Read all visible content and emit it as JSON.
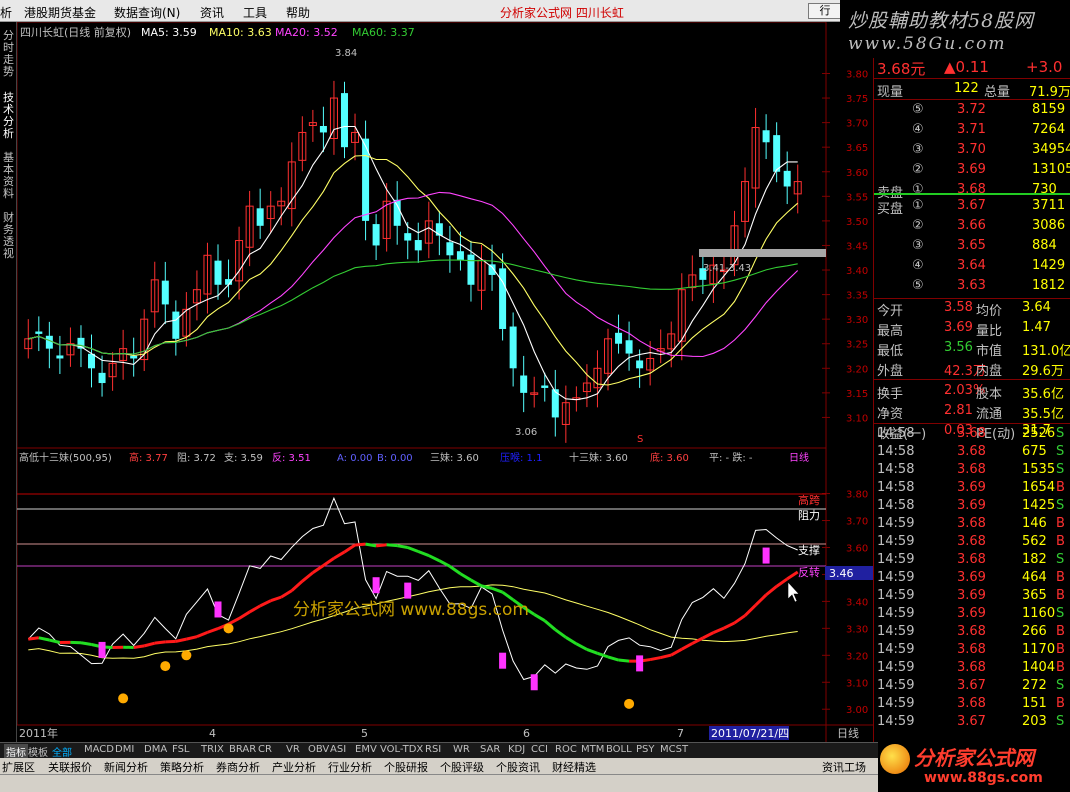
{
  "menu": {
    "items": [
      "析",
      "港股期货基金",
      "数据查询(N)",
      "资讯",
      "工具",
      "帮助"
    ],
    "title": "分析家公式网 四川长虹",
    "mini_btn": "行"
  },
  "watermark": {
    "title": "炒股輔助教材58股网",
    "url": "www.58Gu.com",
    "center_title": "分析家公式网 www.88gs.com",
    "logo_text": "分析家公式网",
    "logo_url": "www.88gs.com"
  },
  "left_tabs": [
    "分时走势",
    "技术分析",
    "基本资料",
    "财务透视"
  ],
  "main_chart": {
    "header": {
      "name": "四川长虹(日线 前复权)",
      "ma5": "MA5: 3.59",
      "ma10": "MA10: 3.63",
      "ma20": "MA20: 3.52",
      "ma60": "MA60: 3.37"
    },
    "ymin": 3.05,
    "ymax": 3.86,
    "y_ticks": [
      "3.80",
      "3.75",
      "3.70",
      "3.65",
      "3.60",
      "3.55",
      "3.50",
      "3.45",
      "3.40",
      "3.35",
      "3.30",
      "3.25",
      "3.20",
      "3.15",
      "3.10"
    ],
    "annotations": {
      "high": "3.84",
      "low": "3.06",
      "band": "3.41-3.43",
      "marker": "S"
    },
    "colors": {
      "up": "#ff3030",
      "down": "#54ffff",
      "ma5": "#ffffff",
      "ma10": "#ffff66",
      "ma20": "#ff44ff",
      "ma60": "#33cc33"
    }
  },
  "chart_data": {
    "type": "candlestick",
    "title": "四川长虹(日线 前复权)",
    "close": [
      3.26,
      3.27,
      3.24,
      3.22,
      3.25,
      3.24,
      3.2,
      3.17,
      3.21,
      3.24,
      3.22,
      3.3,
      3.38,
      3.33,
      3.26,
      3.32,
      3.36,
      3.43,
      3.37,
      3.37,
      3.46,
      3.53,
      3.49,
      3.53,
      3.54,
      3.62,
      3.68,
      3.7,
      3.68,
      3.75,
      3.65,
      3.68,
      3.5,
      3.45,
      3.54,
      3.49,
      3.46,
      3.44,
      3.5,
      3.47,
      3.43,
      3.42,
      3.37,
      3.42,
      3.39,
      3.28,
      3.2,
      3.15,
      3.15,
      3.16,
      3.1,
      3.13,
      3.14,
      3.17,
      3.2,
      3.26,
      3.25,
      3.23,
      3.2,
      3.22,
      3.24,
      3.27,
      3.36,
      3.39,
      3.38,
      3.41,
      3.4,
      3.49,
      3.58,
      3.69,
      3.66,
      3.6,
      3.57,
      3.58
    ],
    "series_visible": [
      "MA5",
      "MA10",
      "MA20",
      "MA60"
    ]
  },
  "indicator": {
    "header": {
      "name": "高低十三妹(500,95)",
      "gao": "高: 3.77",
      "zu": "阻: 3.72",
      "zhi": "支: 3.59",
      "fan": "反: 3.51",
      "a": "A: 0.00",
      "b": "B: 0.00",
      "sanmei": "三妹: 3.60",
      "xihuan": "压喉: 1.1",
      "shisanmei": "十三妹: 3.60",
      "di": "底: 3.60",
      "ping": "平: - 跌: -",
      "period": "日线"
    },
    "ymin": 2.96,
    "ymax": 3.88,
    "y_ticks": [
      "3.80",
      "3.70",
      "3.60",
      "3.50",
      "3.40",
      "3.30",
      "3.20",
      "3.10",
      "3.00"
    ],
    "line_labels": {
      "gao": "高跨",
      "zu": "阻力",
      "zhi": "支撑",
      "fan": "反转",
      "fan_val": "3.46"
    }
  },
  "x_axis": {
    "labels": [
      "2011年",
      "4",
      "5",
      "6",
      "7"
    ],
    "date_box": "2011/07/21/四",
    "period_label": "日线"
  },
  "quote": {
    "price": "3.68元",
    "change": "▲0.11",
    "pct": "+3.0",
    "xianliang_label": "现量",
    "xianliang": "122",
    "zongliang_label": "总量",
    "zongliang": "71.9万",
    "sell": [
      {
        "lv": "⑤",
        "p": "3.72",
        "v": "8159"
      },
      {
        "lv": "④",
        "p": "3.71",
        "v": "7264"
      },
      {
        "lv": "③",
        "p": "3.70",
        "v": "34954"
      },
      {
        "lv": "②",
        "p": "3.69",
        "v": "13105"
      },
      {
        "lv": "①",
        "p": "3.68",
        "v": "730",
        "label": "卖盘"
      }
    ],
    "buy": [
      {
        "lv": "①",
        "p": "3.67",
        "v": "3711",
        "label": "买盘"
      },
      {
        "lv": "②",
        "p": "3.66",
        "v": "3086"
      },
      {
        "lv": "③",
        "p": "3.65",
        "v": "884"
      },
      {
        "lv": "④",
        "p": "3.64",
        "v": "1429"
      },
      {
        "lv": "⑤",
        "p": "3.63",
        "v": "1812"
      }
    ],
    "stats": [
      [
        "今开",
        "3.58",
        "均价",
        "3.64"
      ],
      [
        "最高",
        "3.69",
        "量比",
        "1.47"
      ],
      [
        "最低",
        "3.56",
        "市值",
        "131.0亿"
      ],
      [
        "外盘",
        "42.3万",
        "内盘",
        "29.6万"
      ],
      [
        "换手",
        "2.03%",
        "股本",
        "35.6亿"
      ],
      [
        "净资",
        "2.81",
        "流通",
        "35.5亿"
      ],
      [
        "收益(一)",
        "0.03",
        "PE(动)",
        "31.7"
      ]
    ],
    "ticks": [
      [
        "14:58",
        "3.68",
        "2526",
        "S"
      ],
      [
        "14:58",
        "3.68",
        "675",
        "S"
      ],
      [
        "14:58",
        "3.68",
        "1535",
        "S"
      ],
      [
        "14:58",
        "3.69",
        "1654",
        "B"
      ],
      [
        "14:58",
        "3.69",
        "1425",
        "S"
      ],
      [
        "14:59",
        "3.68",
        "146",
        "B"
      ],
      [
        "14:59",
        "3.68",
        "562",
        "B"
      ],
      [
        "14:59",
        "3.68",
        "182",
        "S"
      ],
      [
        "14:59",
        "3.69",
        "464",
        "B"
      ],
      [
        "14:59",
        "3.69",
        "365",
        "B"
      ],
      [
        "14:59",
        "3.69",
        "1160",
        "S"
      ],
      [
        "14:59",
        "3.68",
        "266",
        "B"
      ],
      [
        "14:59",
        "3.68",
        "1170",
        "B"
      ],
      [
        "14:59",
        "3.68",
        "1404",
        "B"
      ],
      [
        "14:59",
        "3.67",
        "272",
        "S"
      ],
      [
        "14:59",
        "3.68",
        "151",
        "B"
      ],
      [
        "14:59",
        "3.67",
        "203",
        "S"
      ]
    ]
  },
  "bottom": {
    "strip1": [
      "指标",
      "模板",
      "全部",
      "MACD",
      "DMI",
      "DMA",
      "FSL",
      "TRIX",
      "BRAR",
      "CR",
      "VR",
      "OBV",
      "ASI",
      "EMV",
      "VOL-TDX",
      "RSI",
      "WR",
      "SAR",
      "KDJ",
      "CCI",
      "ROC",
      "MTM",
      "BOLL",
      "PSY",
      "MCST"
    ],
    "strip2": [
      "扩展区",
      "关联报价",
      "新闻分析",
      "策略分析",
      "券商分析",
      "产业分析",
      "行业分析",
      "个股研报",
      "个股评级",
      "个股资讯",
      "财经精选"
    ],
    "strip2_right": "资讯工场"
  }
}
